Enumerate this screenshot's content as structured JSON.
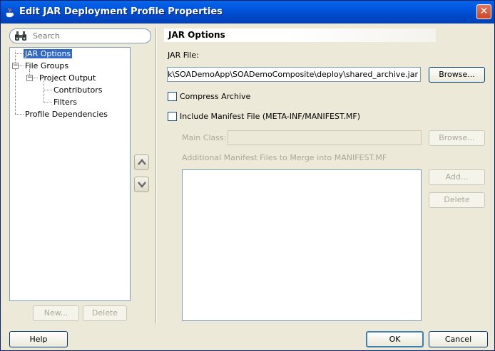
{
  "window": {
    "title": "Edit JAR Deployment Profile Properties",
    "close_glyph": "✕"
  },
  "search": {
    "placeholder": "Search"
  },
  "tree": {
    "items": [
      {
        "label": "JAR Options",
        "selected": true
      },
      {
        "label": "File Groups"
      },
      {
        "label": "Project Output"
      },
      {
        "label": "Contributors"
      },
      {
        "label": "Filters"
      },
      {
        "label": "Profile Dependencies"
      }
    ]
  },
  "left_buttons": {
    "new_label": "New...",
    "delete_label": "Delete"
  },
  "section": {
    "title": "JAR Options"
  },
  "jar_file": {
    "label": "JAR File:",
    "value": "·\\mywork\\SOADemoApp\\SOADemoComposite\\deploy\\shared_archive.jar",
    "browse_label": "Browse..."
  },
  "compress": {
    "label": "Compress Archive",
    "checked": false
  },
  "manifest": {
    "label": "Include Manifest File (META-INF/MANIFEST.MF)",
    "checked": false
  },
  "main_class": {
    "label": "Main Class:",
    "value": "",
    "browse_label": "Browse..."
  },
  "additional": {
    "label": "Additional Manifest Files to Merge into MANIFEST.MF",
    "add_label": "Add...",
    "delete_label": "Delete",
    "files": []
  },
  "footer": {
    "help_label": "Help",
    "ok_label": "OK",
    "cancel_label": "Cancel"
  },
  "colors": {
    "titlebar": "#0054e3",
    "selection": "#316ac5",
    "dialog_bg": "#ece9d8"
  }
}
